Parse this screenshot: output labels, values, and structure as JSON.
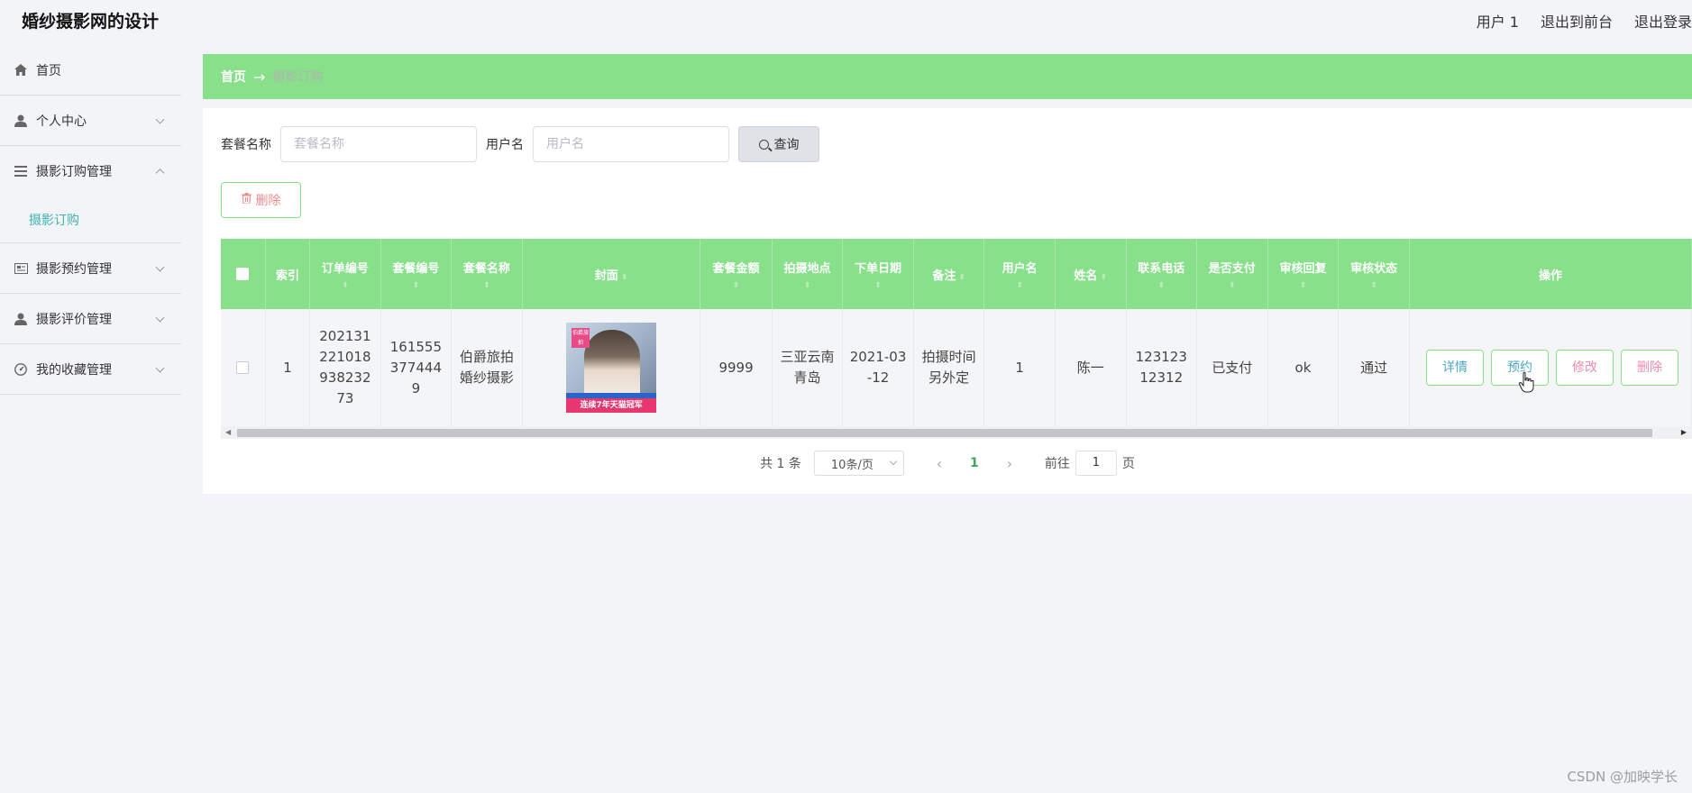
{
  "header": {
    "title": "婚纱摄影网的设计",
    "links": [
      "用户 1",
      "退出到前台",
      "退出登录"
    ]
  },
  "sidebar": {
    "items": [
      {
        "label": "首页",
        "icon": "home-icon"
      },
      {
        "label": "个人中心",
        "icon": "user-icon"
      },
      {
        "label": "摄影订购管理",
        "icon": "list-icon",
        "expanded": true,
        "children": [
          "摄影订购"
        ]
      },
      {
        "label": "摄影预约管理",
        "icon": "card-icon"
      },
      {
        "label": "摄影评价管理",
        "icon": "user-icon"
      },
      {
        "label": "我的收藏管理",
        "icon": "gauge-icon"
      }
    ]
  },
  "breadcrumb": {
    "home": "首页",
    "separator": "→",
    "current": "摄影订购"
  },
  "search": {
    "package_label": "套餐名称",
    "package_placeholder": "套餐名称",
    "user_label": "用户名",
    "user_placeholder": "用户名",
    "query_label": "查询"
  },
  "toolbar": {
    "delete_label": "删除"
  },
  "table": {
    "columns": [
      "索引",
      "订单编号",
      "套餐编号",
      "套餐名称",
      "封面",
      "套餐金额",
      "拍摄地点",
      "下单日期",
      "备注",
      "用户名",
      "姓名",
      "联系电话",
      "是否支付",
      "审核回复",
      "审核状态",
      "操作"
    ],
    "rows": [
      {
        "index": "1",
        "order_no": "20213122101893823273",
        "package_no": "1615553774449",
        "package_name": "伯爵旅拍婚纱摄影",
        "cover_tag": "伯爵旅拍",
        "cover_banner": "连续7年天猫冠军",
        "amount": "9999",
        "location": "三亚云南青岛",
        "order_date": "2021-03-12",
        "remark": "拍摄时间另外定",
        "username": "1",
        "name": "陈一",
        "phone": "12312312312",
        "paid": "已支付",
        "review_reply": "ok",
        "review_status": "通过"
      }
    ],
    "actions": [
      "详情",
      "预约",
      "修改",
      "删除"
    ]
  },
  "pagination": {
    "total": "共 1 条",
    "page_size": "10条/页",
    "current_page": "1",
    "goto_label": "前往",
    "goto_value": "1",
    "page_suffix": "页"
  },
  "watermark": "CSDN @加映学长",
  "colors": {
    "accent_green": "#88e08b",
    "active_teal": "#3fb4b0",
    "danger_pink": "#f08ab0"
  }
}
